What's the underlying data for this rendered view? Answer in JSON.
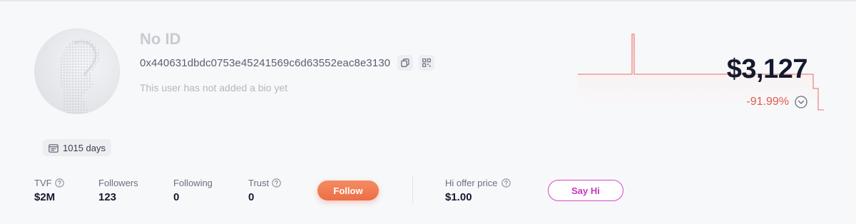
{
  "profile": {
    "name": "No ID",
    "address": "0x440631dbdc0753e45241569c6d63552eac8e3130",
    "bio": "This user has not added a bio yet",
    "days": "1015 days"
  },
  "portfolio": {
    "balance": "$3,127",
    "change": "-91.99%",
    "change_color": "#e05a4e"
  },
  "stats": {
    "tvf": {
      "label": "TVF",
      "value": "$2M"
    },
    "followers": {
      "label": "Followers",
      "value": "123"
    },
    "following": {
      "label": "Following",
      "value": "0"
    },
    "trust": {
      "label": "Trust",
      "value": "0"
    },
    "hi_offer": {
      "label": "Hi offer price",
      "value": "$1.00"
    }
  },
  "buttons": {
    "follow": "Follow",
    "say_hi": "Say Hi"
  },
  "icons": {
    "copy": "copy-icon",
    "qr": "qr-code-icon",
    "calendar": "calendar-icon",
    "help": "help-circle-icon",
    "toggle": "chevron-down-circle-icon"
  },
  "colors": {
    "follow_button": "#ec6e47",
    "say_hi_border": "#d944c8",
    "sparkline": "#ec8a84"
  }
}
